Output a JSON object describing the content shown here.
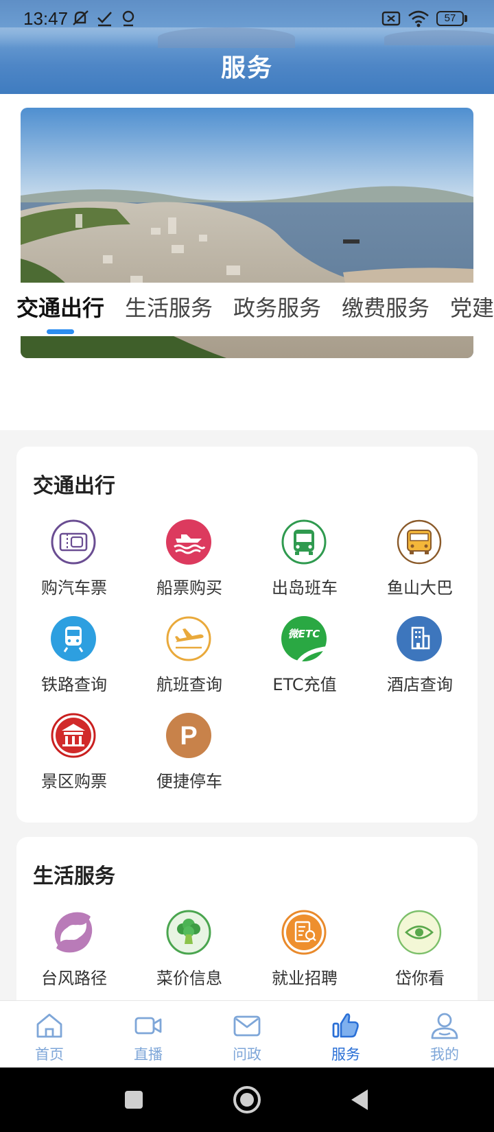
{
  "status_bar": {
    "time": "13:47",
    "battery": "57"
  },
  "header": {
    "title": "服务"
  },
  "tabs": [
    {
      "label": "交通出行",
      "active": true
    },
    {
      "label": "生活服务",
      "active": false
    },
    {
      "label": "政务服务",
      "active": false
    },
    {
      "label": "缴费服务",
      "active": false
    },
    {
      "label": "党建",
      "active": false
    }
  ],
  "sections": [
    {
      "title": "交通出行",
      "items": [
        {
          "label": "购汽车票",
          "icon": "bus-ticket-icon"
        },
        {
          "label": "船票购买",
          "icon": "ship-icon"
        },
        {
          "label": "出岛班车",
          "icon": "bus-icon"
        },
        {
          "label": "鱼山大巴",
          "icon": "coach-icon"
        },
        {
          "label": "铁路查询",
          "icon": "train-icon"
        },
        {
          "label": "航班查询",
          "icon": "plane-icon"
        },
        {
          "label": "ETC充值",
          "icon": "etc-icon"
        },
        {
          "label": "酒店查询",
          "icon": "hotel-icon"
        },
        {
          "label": "景区购票",
          "icon": "scenic-icon"
        },
        {
          "label": "便捷停车",
          "icon": "parking-icon"
        }
      ]
    },
    {
      "title": "生活服务",
      "items": [
        {
          "label": "台风路径",
          "icon": "typhoon-icon"
        },
        {
          "label": "菜价信息",
          "icon": "vegetable-icon"
        },
        {
          "label": "就业招聘",
          "icon": "job-icon"
        },
        {
          "label": "岱你看",
          "icon": "eye-icon"
        }
      ]
    }
  ],
  "icon_text": {
    "etc": "微ETC",
    "parking": "P"
  },
  "bottom_nav": [
    {
      "label": "首页",
      "icon": "home-icon",
      "active": false
    },
    {
      "label": "直播",
      "icon": "video-icon",
      "active": false
    },
    {
      "label": "问政",
      "icon": "mail-icon",
      "active": false
    },
    {
      "label": "服务",
      "icon": "thumbs-up-icon",
      "active": true
    },
    {
      "label": "我的",
      "icon": "user-icon",
      "active": false
    }
  ],
  "colors": {
    "accent": "#2c8df0",
    "nav_active": "#2a6fd6",
    "nav_inactive": "#7ea6d8"
  }
}
